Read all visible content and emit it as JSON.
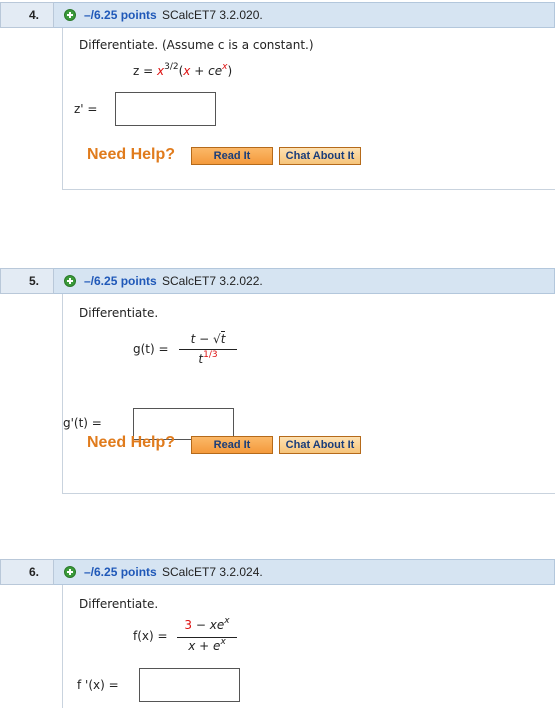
{
  "questions": [
    {
      "number": "4.",
      "points": "–/6.25 points",
      "ref": "SCalcET7 3.2.020.",
      "prompt": "Differentiate. (Assume c is a constant.)",
      "answer_label": "z' =",
      "need_help": "Need Help?",
      "read_it": "Read It",
      "chat_about_it": "Chat About It"
    },
    {
      "number": "5.",
      "points": "–/6.25 points",
      "ref": "SCalcET7 3.2.022.",
      "prompt": "Differentiate.",
      "answer_label": "g'(t) =",
      "need_help": "Need Help?",
      "read_it": "Read It",
      "chat_about_it": "Chat About It"
    },
    {
      "number": "6.",
      "points": "–/6.25 points",
      "ref": "SCalcET7 3.2.024.",
      "prompt": "Differentiate.",
      "answer_label": "f '(x) ="
    }
  ],
  "formulas": {
    "q4": {
      "lhs": "z =",
      "base": "x",
      "exp": "3/2",
      "open": "(",
      "x": "x",
      "plus": "+",
      "c": "c",
      "e": "e",
      "ex": "x",
      "close": ")"
    },
    "q5": {
      "lhs": "g(t) =",
      "num_t": "t",
      "minus": "−",
      "sqrt": "√",
      "num_rt": "t",
      "den_base": "t",
      "den_exp": "1/3"
    },
    "q6": {
      "lhs": "f(x) =",
      "num_3": "3",
      "minus": "−",
      "num_x": "x",
      "num_e": "e",
      "num_ex": "x",
      "den_x": "x",
      "plus": "+",
      "den_e": "e",
      "den_ex": "x"
    }
  },
  "colors": {
    "points": "#1f58b8",
    "need_help": "#e07b1c",
    "header_bg": "#d6e4f2",
    "variable_red": "#dd1111"
  }
}
